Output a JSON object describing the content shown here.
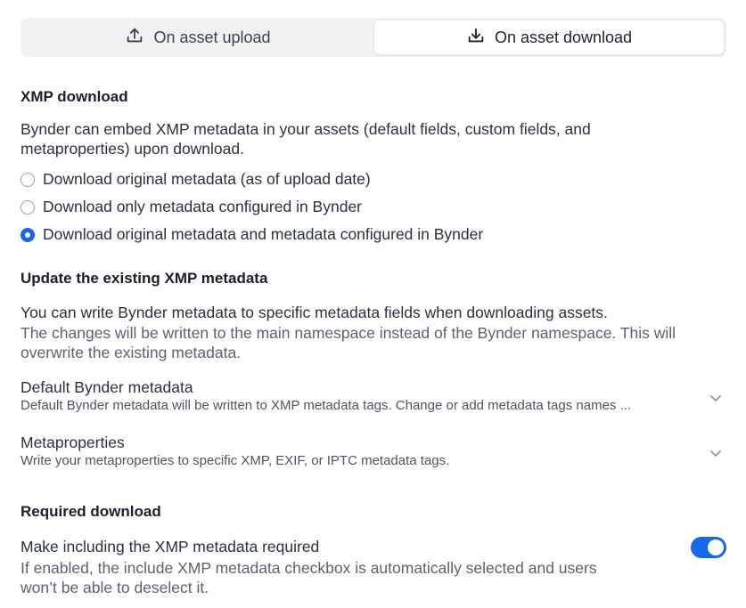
{
  "tabs": {
    "upload_label": "On asset upload",
    "download_label": "On asset download",
    "selected": "download"
  },
  "xmp_download": {
    "heading": "XMP download",
    "desc_line1": "Bynder can embed XMP metadata in your assets (default fields, custom fields, and",
    "desc_line2": "metaproperties) upon download.",
    "options": [
      {
        "label": "Download original metadata (as of upload date)",
        "checked": false
      },
      {
        "label": "Download only metadata configured in Bynder",
        "checked": false
      },
      {
        "label": "Download original metadata and metadata configured in Bynder",
        "checked": true
      }
    ]
  },
  "update_xmp": {
    "heading": "Update the existing XMP metadata",
    "desc_line1": "You can write Bynder metadata to specific metadata fields when downloading assets.",
    "desc_line2": "The changes will be written to the main namespace instead of the Bynder namespace. This will",
    "desc_line3": "overwrite the existing metadata.",
    "accordions": [
      {
        "title": "Default Bynder metadata",
        "desc": "Default Bynder metadata will be written to XMP metadata tags. Change or add metadata tags names ..."
      },
      {
        "title": "Metaproperties",
        "desc": "Write your metaproperties to specific XMP, EXIF, or IPTC metadata tags."
      }
    ]
  },
  "required_download": {
    "heading": "Required download",
    "toggle_label": "Make including the XMP metadata required",
    "help_line1": "If enabled, the include XMP metadata checkbox is automatically selected and users",
    "help_line2": "won’t be able to deselect it.",
    "enabled": true
  },
  "colors": {
    "accent": "#1668e8",
    "tab_bg": "#f1f2f4",
    "text": "#1c2230"
  }
}
